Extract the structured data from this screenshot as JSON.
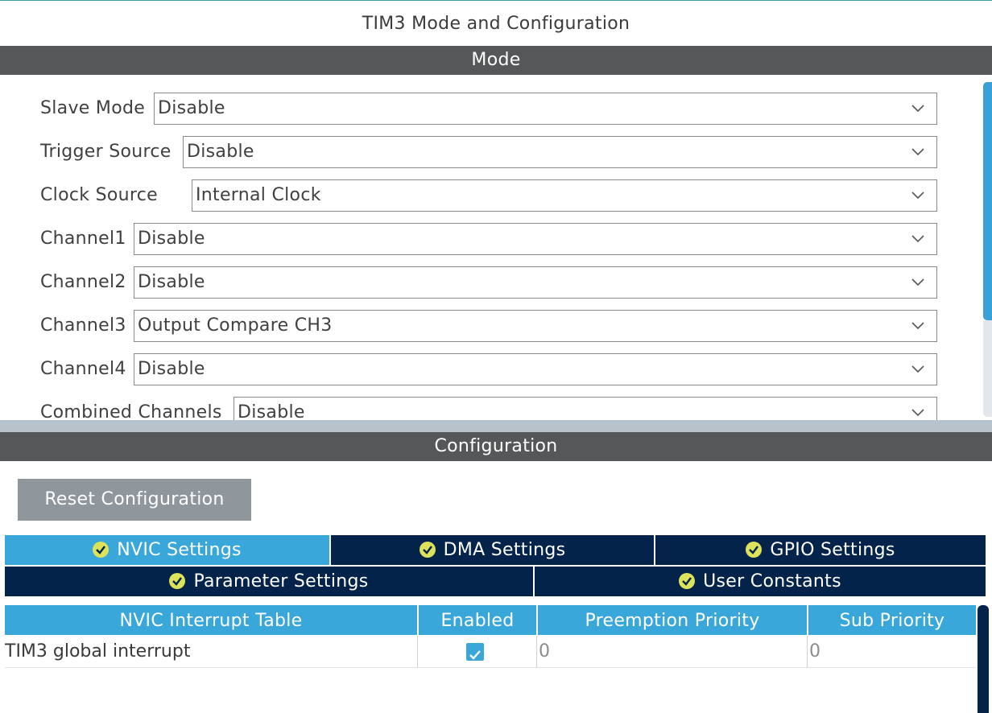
{
  "window": {
    "title": "TIM3 Mode and Configuration"
  },
  "mode": {
    "header": "Mode",
    "fields": [
      {
        "label": "Slave Mode",
        "value": "Disable"
      },
      {
        "label": "Trigger Source",
        "value": "Disable"
      },
      {
        "label": "Clock Source",
        "value": "Internal Clock"
      },
      {
        "label": "Channel1",
        "value": "Disable"
      },
      {
        "label": "Channel2",
        "value": "Disable"
      },
      {
        "label": "Channel3",
        "value": "Output Compare CH3"
      },
      {
        "label": "Channel4",
        "value": "Disable"
      },
      {
        "label": "Combined Channels",
        "value": "Disable"
      }
    ]
  },
  "configuration": {
    "header": "Configuration",
    "reset_label": "Reset Configuration",
    "tabs_row1": [
      {
        "label": "NVIC Settings",
        "active": true
      },
      {
        "label": "DMA Settings",
        "active": false
      },
      {
        "label": "GPIO Settings",
        "active": false
      }
    ],
    "tabs_row2": [
      {
        "label": "Parameter Settings",
        "active": false
      },
      {
        "label": "User Constants",
        "active": false
      }
    ],
    "table": {
      "columns": [
        "NVIC Interrupt Table",
        "Enabled",
        "Preemption Priority",
        "Sub Priority"
      ],
      "rows": [
        {
          "name": "TIM3 global interrupt",
          "enabled": true,
          "preemption": "0",
          "sub": "0"
        }
      ]
    }
  },
  "colors": {
    "section_bar": "#555758",
    "tab_active": "#3aa7db",
    "tab_inactive": "#03234b",
    "check_badge": "#dce35b",
    "reset_button": "#8f979d"
  },
  "icons": {
    "dropdown": "chevron-down-icon",
    "tab_status": "check-circle-icon",
    "enabled": "checkbox-checked-icon"
  }
}
